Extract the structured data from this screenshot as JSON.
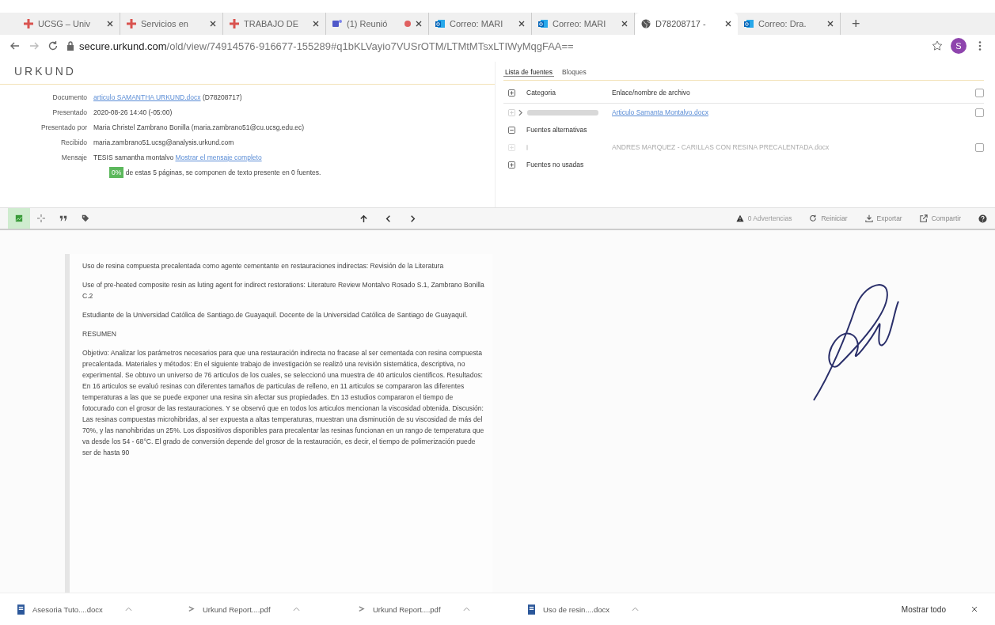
{
  "browser_tabs": [
    {
      "title": "UCSG – Univ",
      "kind": "cross",
      "selected": false
    },
    {
      "title": "Servicios en",
      "kind": "cross",
      "selected": false
    },
    {
      "title": "TRABAJO DE",
      "kind": "cross",
      "selected": false
    },
    {
      "title": "(1) Reunió",
      "kind": "teams",
      "selected": false,
      "recording": true
    },
    {
      "title": "Correo: MARI",
      "kind": "outlook",
      "selected": false
    },
    {
      "title": "Correo: MARI",
      "kind": "outlook",
      "selected": false
    },
    {
      "title": "D78208717 -",
      "kind": "globe",
      "selected": true
    },
    {
      "title": "Correo: Dra.",
      "kind": "outlook",
      "selected": false
    }
  ],
  "new_tab": "+",
  "address_bar": {
    "host": "secure.urkund.com",
    "path": "/old/view/74914576-916677-155289#q1bKLVayio7VUSrOTM/LTMtMTsxLTIWyMqgFAA=="
  },
  "profile": "S",
  "logo": "URKUND",
  "info": [
    {
      "label": "Documento",
      "value": "articulo SAMANTHA URKUND.docx",
      "kind": "link",
      "extra": "(D78208717)"
    },
    {
      "label": "Presentado",
      "value": "2020-08-26 14:40 (-05:00)",
      "kind": "text"
    },
    {
      "label": "Presentado por",
      "value": "Maria Christel Zambrano Bonilla (maria.zambrano51@cu.ucsg.edu.ec)",
      "kind": "text"
    },
    {
      "label": "Recibido",
      "value": "maria.zambrano51.ucsg@analysis.urkund.com",
      "kind": "text"
    },
    {
      "label": "Mensaje",
      "value": "TESIS samantha montalvo",
      "kind": "message",
      "extra": "Mostrar el mensaje completo"
    }
  ],
  "match": {
    "percent": "0%",
    "text": "de estas 5 páginas, se componen de texto presente en 0 fuentes."
  },
  "panel_tabs": [
    {
      "label": "Lista de fuentes",
      "selected": true
    },
    {
      "label": "Bloques",
      "selected": false
    }
  ],
  "sources": [
    {
      "kind": "header",
      "category": "Categoria",
      "name": "Enlace/nombre de archivo",
      "checked": false
    },
    {
      "kind": "source",
      "name": "Articulo Samanta Montalvo.docx",
      "disabled": false,
      "checked": false
    },
    {
      "kind": "group",
      "category": "Fuentes alternativas",
      "expanded": true
    },
    {
      "kind": "source",
      "name": "ANDRES MARQUEZ - CARILLAS CON RESINA PRECALENTADA.docx",
      "disabled": true,
      "checked": false
    },
    {
      "kind": "group",
      "category": "Fuentes no usadas",
      "expanded": false
    }
  ],
  "toolbar_tools": [
    {
      "kind": "chart",
      "selected": true
    },
    {
      "kind": "target",
      "selected": false
    },
    {
      "kind": "quote",
      "selected": false
    },
    {
      "kind": "tag",
      "selected": false
    }
  ],
  "toolbar_actions": [
    {
      "kind": "warning",
      "label": "0 Advertencias"
    },
    {
      "kind": "refresh",
      "label": "Reiniciar"
    },
    {
      "kind": "download",
      "label": "Exportar"
    },
    {
      "kind": "share",
      "label": "Compartir"
    }
  ],
  "document": [
    "Uso de resina compuesta precalentada como agente cementante en restauraciones indirectas: Revisión de la Literatura",
    "Use of pre-heated composite resin as luting agent for indirect restorations: Literature Review Montalvo Rosado S.1, Zambrano Bonilla C.2",
    "Estudiante de la Universidad Católica de Santiago.de Guayaquil. Docente de la Universidad Católica de Santiago de Guayaquil.",
    "RESUMEN",
    "Objetivo: Analizar los parámetros necesarios para que una restauración indirecta no fracase al ser cementada con resina compuesta precalentada. Materiales y métodos: En el siguiente trabajo de investigación se realizó una revisión sistemática, descriptiva, no experimental. Se obtuvo un universo de 76 articulos de los cuales, se seleccionó una muestra de 40 articulos cientificos. Resultados: En 16 articulos se evaluó resinas con diferentes tamaños de particulas de relleno, en 11 articulos se compararon las diferentes temperaturas a las que se puede exponer una resina sin afectar sus propiedades. En 13 estudios compararon el tiempo de fotocurado con el grosor de las restauraciones. Y se observó que en todos los articulos mencionan la viscosidad obtenida. Discusión: Las resinas compuestas microhibridas, al ser expuesta a altas temperaturas, muestran una disminución de su viscosidad de más del 70%, y las nanohibridas un 25%. Los dispositivos disponibles para precalentar las resinas funcionan en un rango de temperatura que va desde los 54 - 68°C. El grado de conversión depende del grosor de la restauración, es decir, el tiempo de polimerización puede ser de hasta 90"
  ],
  "downloads": [
    {
      "name": "Asesoria Tuto....docx",
      "kind": "docx"
    },
    {
      "name": "Urkund Report....pdf",
      "kind": "pdf"
    },
    {
      "name": "Urkund Report....pdf",
      "kind": "pdf"
    },
    {
      "name": "Uso de resin....docx",
      "kind": "docx"
    }
  ],
  "show_all": "Mostrar todo"
}
